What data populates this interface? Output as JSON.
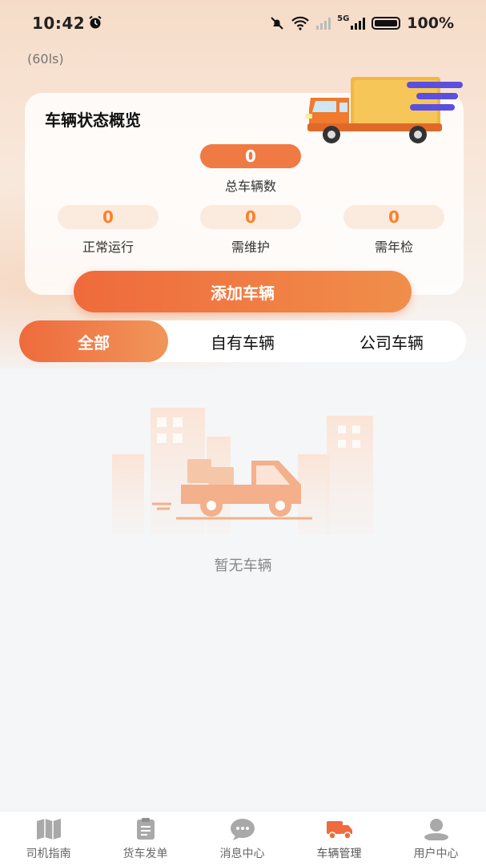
{
  "status_bar": {
    "time": "10:42",
    "battery": "100%",
    "net_5g": "5G"
  },
  "tag": "(60ls)",
  "overview": {
    "title": "车辆状态概览",
    "total": {
      "value": "0",
      "label": "总车辆数"
    },
    "stats": [
      {
        "value": "0",
        "label": "正常运行"
      },
      {
        "value": "0",
        "label": "需维护"
      },
      {
        "value": "0",
        "label": "需年检"
      }
    ],
    "add_button": "添加车辆"
  },
  "tabs": [
    {
      "label": "全部",
      "active": true
    },
    {
      "label": "自有车辆",
      "active": false
    },
    {
      "label": "公司车辆",
      "active": false
    }
  ],
  "empty_text": "暂无车辆",
  "bottom_nav": [
    {
      "label": "司机指南",
      "icon": "map-icon"
    },
    {
      "label": "货车发单",
      "icon": "clipboard-icon"
    },
    {
      "label": "消息中心",
      "icon": "chat-bubble-icon"
    },
    {
      "label": "车辆管理",
      "icon": "truck-icon",
      "active": true
    },
    {
      "label": "用户中心",
      "icon": "user-icon"
    }
  ],
  "colors": {
    "accent": "#ef6a3c",
    "accent_light": "#fbeade",
    "stat_text": "#ff7f2a"
  }
}
